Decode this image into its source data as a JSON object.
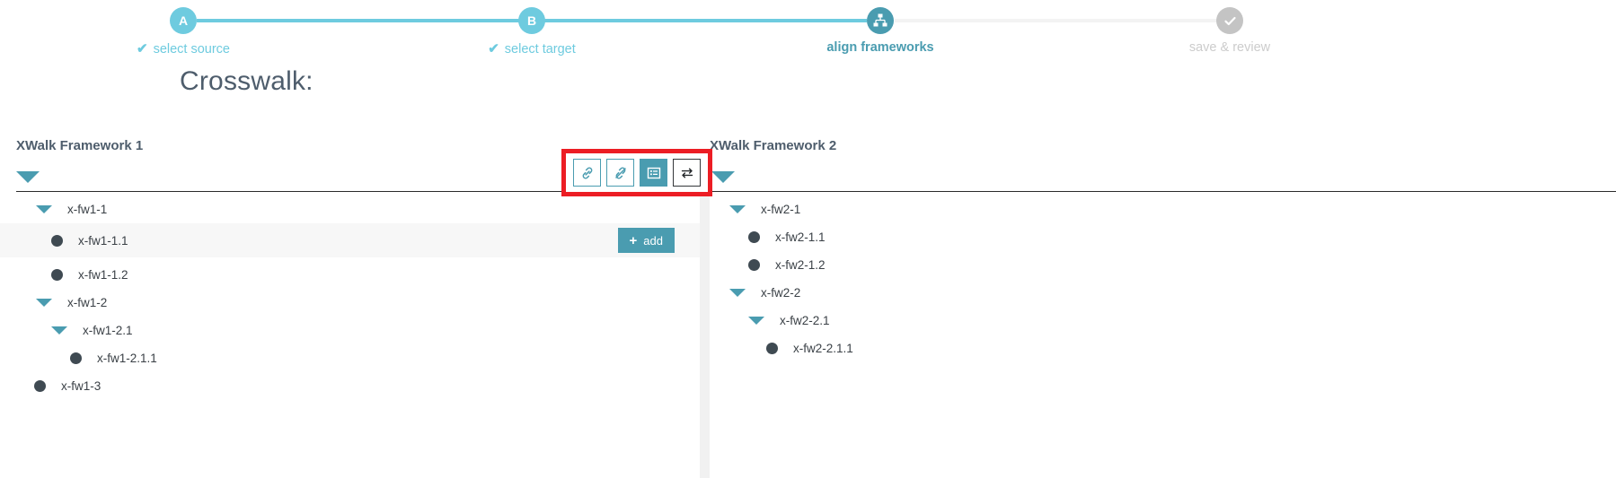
{
  "stepper": {
    "steps": [
      {
        "bullet": "A",
        "label": "select source",
        "state": "done",
        "icon": "letter-a",
        "check": "✔"
      },
      {
        "bullet": "B",
        "label": "select target",
        "state": "done",
        "icon": "letter-b",
        "check": "✔"
      },
      {
        "bullet": "",
        "label": "align frameworks",
        "state": "active",
        "icon": "sitemap-icon",
        "check": ""
      },
      {
        "bullet": "",
        "label": "save & review",
        "state": "todo",
        "icon": "check-circle-icon",
        "check": ""
      }
    ],
    "colors": {
      "done": "#6ecbdf",
      "active": "#4a9cb0",
      "todo": "#c4c4c4",
      "track_empty": "#f3f3f3"
    }
  },
  "page_title": "Crosswalk:",
  "toolbar": {
    "buttons": [
      {
        "icon": "link-icon",
        "label": "link",
        "active": false,
        "style": "teal"
      },
      {
        "icon": "unlink-icon",
        "label": "unlink",
        "active": false,
        "style": "teal"
      },
      {
        "icon": "list-icon",
        "label": "list",
        "active": true,
        "style": "teal"
      },
      {
        "icon": "swap-icon",
        "label": "swap",
        "active": false,
        "style": "dark"
      }
    ],
    "highlight_color": "#ec1d24",
    "accent_color": "#4a9cb0"
  },
  "panels": {
    "left": {
      "title": "XWalk Framework 1",
      "nodes": [
        {
          "label": "x-fw1-1",
          "type": "caret",
          "indent": 40,
          "highlight": false,
          "add": false
        },
        {
          "label": "x-fw1-1.1",
          "type": "dot",
          "indent": 57,
          "highlight": true,
          "add": true
        },
        {
          "label": "x-fw1-1.2",
          "type": "dot",
          "indent": 57,
          "highlight": false,
          "add": false
        },
        {
          "label": "x-fw1-2",
          "type": "caret",
          "indent": 40,
          "highlight": false,
          "add": false
        },
        {
          "label": "x-fw1-2.1",
          "type": "caret",
          "indent": 57,
          "highlight": false,
          "add": false
        },
        {
          "label": "x-fw1-2.1.1",
          "type": "dot",
          "indent": 78,
          "highlight": false,
          "add": false
        },
        {
          "label": "x-fw1-3",
          "type": "dot",
          "indent": 38,
          "highlight": false,
          "add": false
        }
      ],
      "add_button_label": "add",
      "add_button_plus": "+"
    },
    "right": {
      "title": "XWalk Framework 2",
      "nodes": [
        {
          "label": "x-fw2-1",
          "type": "caret",
          "indent": 22,
          "highlight": false,
          "add": false
        },
        {
          "label": "x-fw2-1.1",
          "type": "dot",
          "indent": 43,
          "highlight": false,
          "add": false
        },
        {
          "label": "x-fw2-1.2",
          "type": "dot",
          "indent": 43,
          "highlight": false,
          "add": false
        },
        {
          "label": "x-fw2-2",
          "type": "caret",
          "indent": 22,
          "highlight": false,
          "add": false
        },
        {
          "label": "x-fw2-2.1",
          "type": "caret",
          "indent": 43,
          "highlight": false,
          "add": false
        },
        {
          "label": "x-fw2-2.1.1",
          "type": "dot",
          "indent": 63,
          "highlight": false,
          "add": false
        }
      ]
    }
  }
}
